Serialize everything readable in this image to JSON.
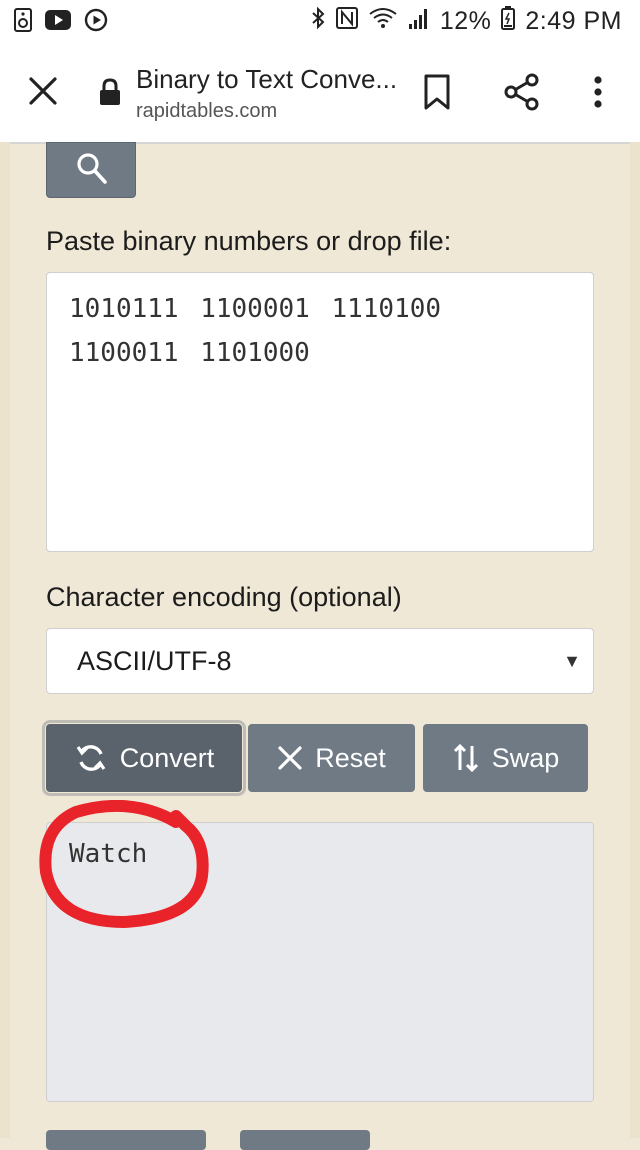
{
  "status_bar": {
    "battery": "12%",
    "time": "2:49 PM",
    "icons": [
      "speaker-icon",
      "youtube-icon",
      "play-icon",
      "bluetooth-icon",
      "nfc-icon",
      "wifi-icon",
      "signal-icon",
      "battery-icon"
    ]
  },
  "tab_bar": {
    "title": "Binary to Text Conve...",
    "url": "rapidtables.com",
    "icons": [
      "close-icon",
      "lock-icon",
      "bookmark-icon",
      "share-icon",
      "more-icon"
    ]
  },
  "form": {
    "input_label": "Paste binary numbers or drop file:",
    "input_value": "1010111 1100001 1110100\n1100011 1101000",
    "encoding_label": "Character encoding (optional)",
    "encoding_value": "ASCII/UTF-8",
    "convert_label": "Convert",
    "reset_label": "Reset",
    "swap_label": "Swap",
    "output_value": "Watch"
  },
  "colors": {
    "page_bg": "#f0e8d6",
    "button_bg": "#6f7a84",
    "annotation": "#e8232a"
  }
}
